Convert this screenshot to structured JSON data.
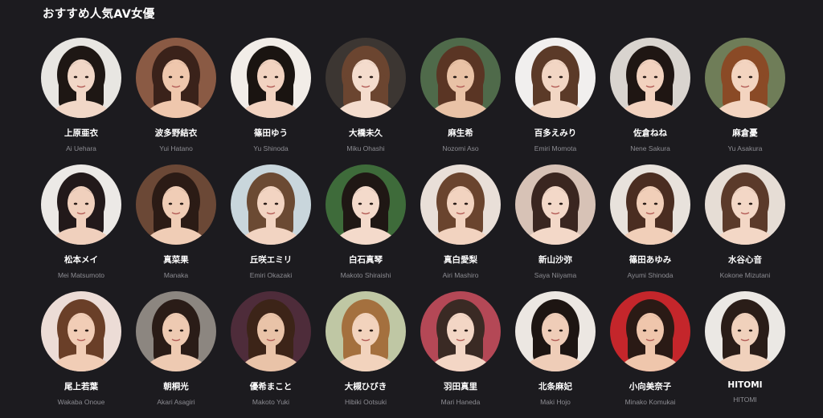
{
  "section": {
    "title": "おすすめ人気AV女優"
  },
  "actresses": [
    {
      "name_jp": "上原亜衣",
      "name_en": "Ai Uehara",
      "bg": "#e8e6e2",
      "hair": "#1e1714",
      "skin": "#f1d7c7"
    },
    {
      "name_jp": "波多野結衣",
      "name_en": "Yui Hatano",
      "bg": "#8a5a44",
      "hair": "#3a221a",
      "skin": "#efc7ad"
    },
    {
      "name_jp": "篠田ゆう",
      "name_en": "Yu Shinoda",
      "bg": "#f2ede8",
      "hair": "#1a1411",
      "skin": "#f2d3c1"
    },
    {
      "name_jp": "大橋未久",
      "name_en": "Miku Ohashi",
      "bg": "#3c3632",
      "hair": "#6b4530",
      "skin": "#f4dccd"
    },
    {
      "name_jp": "麻生希",
      "name_en": "Nozomi Aso",
      "bg": "#4f6a4a",
      "hair": "#5a3524",
      "skin": "#e9c2a6"
    },
    {
      "name_jp": "百多えみり",
      "name_en": "Emiri Momota",
      "bg": "#f1efee",
      "hair": "#5b3a28",
      "skin": "#f2d6c4"
    },
    {
      "name_jp": "佐倉ねね",
      "name_en": "Nene Sakura",
      "bg": "#d9d4cf",
      "hair": "#1f1613",
      "skin": "#f2d2bf"
    },
    {
      "name_jp": "麻倉憂",
      "name_en": "Yu Asakura",
      "bg": "#6f7d58",
      "hair": "#8a4a26",
      "skin": "#f3d4c0"
    },
    {
      "name_jp": "松本メイ",
      "name_en": "Mei Matsumoto",
      "bg": "#ece9e6",
      "hair": "#22191a",
      "skin": "#f0d0bd"
    },
    {
      "name_jp": "真菜果",
      "name_en": "Manaka",
      "bg": "#6b4836",
      "hair": "#2b1b15",
      "skin": "#f0cdb6"
    },
    {
      "name_jp": "丘咲エミリ",
      "name_en": "Emiri Okazaki",
      "bg": "#c9d6dc",
      "hair": "#6b4a33",
      "skin": "#f2d4c2"
    },
    {
      "name_jp": "白石真琴",
      "name_en": "Makoto Shiraishi",
      "bg": "#3e6b3a",
      "hair": "#1f1714",
      "skin": "#f4dacb"
    },
    {
      "name_jp": "真白愛梨",
      "name_en": "Airi Mashiro",
      "bg": "#e9dfd8",
      "hair": "#6a442e",
      "skin": "#f2d3c0"
    },
    {
      "name_jp": "新山沙弥",
      "name_en": "Saya Niiyama",
      "bg": "#d7c2b6",
      "hair": "#3a2620",
      "skin": "#f3d8c8"
    },
    {
      "name_jp": "篠田あゆみ",
      "name_en": "Ayumi Shinoda",
      "bg": "#e8e2dc",
      "hair": "#4a2d21",
      "skin": "#f1cfb9"
    },
    {
      "name_jp": "水谷心音",
      "name_en": "Kokone Mizutani",
      "bg": "#e6ddd5",
      "hair": "#5b3a2a",
      "skin": "#f3d7c6"
    },
    {
      "name_jp": "尾上若葉",
      "name_en": "Wakaba Onoue",
      "bg": "#ecdcd6",
      "hair": "#6a3f28",
      "skin": "#f1cdb6"
    },
    {
      "name_jp": "朝桐光",
      "name_en": "Akari Asagiri",
      "bg": "#8c8680",
      "hair": "#2a1c17",
      "skin": "#eecab2"
    },
    {
      "name_jp": "優希まこと",
      "name_en": "Makoto Yuki",
      "bg": "#4e2c3a",
      "hair": "#3c2418",
      "skin": "#e9c3a8"
    },
    {
      "name_jp": "大槻ひびき",
      "name_en": "Hibiki Ootsuki",
      "bg": "#bfc7a4",
      "hair": "#a4703e",
      "skin": "#f2d3bd"
    },
    {
      "name_jp": "羽田真里",
      "name_en": "Mari Haneda",
      "bg": "#b44856",
      "hair": "#3a2a24",
      "skin": "#f3d6c5"
    },
    {
      "name_jp": "北条麻妃",
      "name_en": "Maki Hojo",
      "bg": "#ece7e2",
      "hair": "#1d1512",
      "skin": "#efcdb8"
    },
    {
      "name_jp": "小向美奈子",
      "name_en": "Minako Komukai",
      "bg": "#c4262b",
      "hair": "#2a1a15",
      "skin": "#efc6ac"
    },
    {
      "name_jp": "HITOMI",
      "name_en": "HITOMI",
      "bg": "#ebe8e4",
      "hair": "#2a1d18",
      "skin": "#f0d1bc"
    }
  ]
}
